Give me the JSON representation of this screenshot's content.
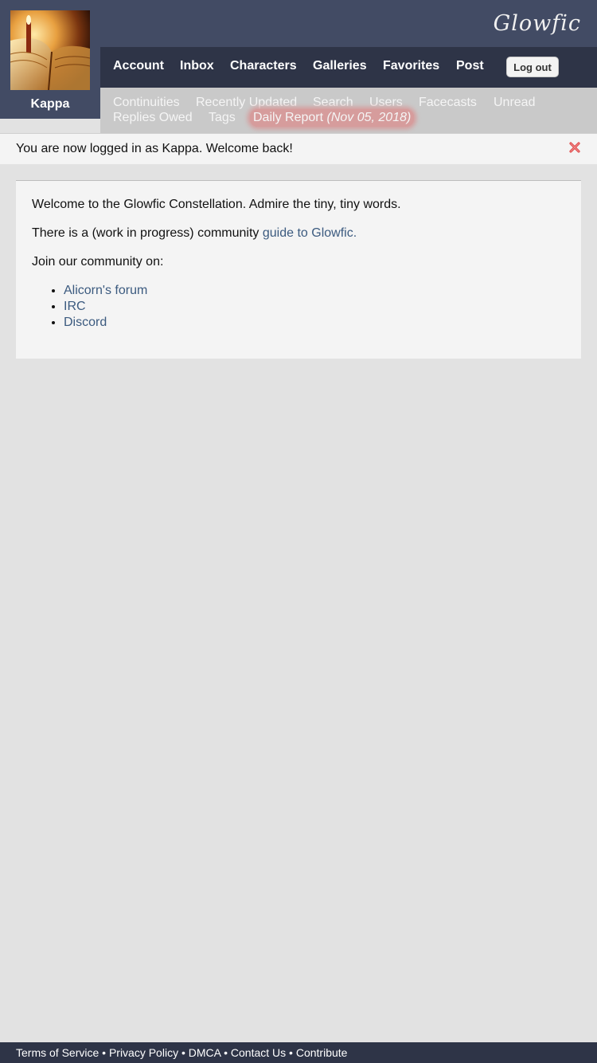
{
  "user": {
    "name": "Kappa"
  },
  "brand": {
    "logo_text": "Glowfic"
  },
  "nav": {
    "items": [
      "Account",
      "Inbox",
      "Characters",
      "Galleries",
      "Favorites",
      "Post"
    ],
    "logout_label": "Log out"
  },
  "subnav": {
    "items": [
      "Continuities",
      "Recently Updated",
      "Search",
      "Users",
      "Facecasts",
      "Unread",
      "Replies Owed",
      "Tags"
    ],
    "daily_report_label": "Daily Report",
    "daily_report_date": "(Nov 05, 2018)"
  },
  "flash": {
    "message": "You are now logged in as Kappa. Welcome back!"
  },
  "content": {
    "welcome": "Welcome to the Glowfic Constellation. Admire the tiny, tiny words.",
    "guide_prefix": "There is a (work in progress) community",
    "guide_link": "guide to Glowfic.",
    "join_text": "Join our community on:",
    "links": [
      "Alicorn's forum",
      "IRC",
      "Discord"
    ]
  },
  "footer": {
    "links": [
      "Terms of Service",
      "Privacy Policy",
      "DMCA",
      "Contact Us",
      "Contribute"
    ],
    "separator": "•"
  },
  "colors": {
    "header_bg": "#424b64",
    "nav_bg": "#2e3447",
    "link": "#3b5a7f",
    "highlight": "#d69c9c",
    "close": "#e05050"
  }
}
